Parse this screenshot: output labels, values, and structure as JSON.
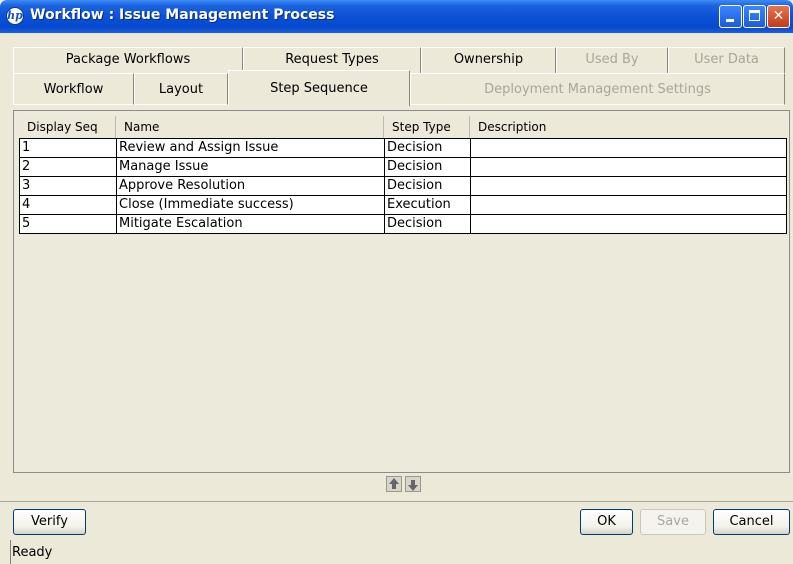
{
  "window": {
    "title": "Workflow : Issue Management Process",
    "icon": "hp-logo-icon",
    "icon_glyph": "hp"
  },
  "tabs": {
    "row1": [
      {
        "label": "Package Workflows",
        "enabled": true
      },
      {
        "label": "Request Types",
        "enabled": true
      },
      {
        "label": "Ownership",
        "enabled": true
      },
      {
        "label": "Used By",
        "enabled": false
      },
      {
        "label": "User Data",
        "enabled": false
      }
    ],
    "row2": [
      {
        "label": "Workflow",
        "enabled": true
      },
      {
        "label": "Layout",
        "enabled": true
      },
      {
        "label": "Step Sequence",
        "enabled": true,
        "selected": true
      },
      {
        "label": "Deployment Management Settings",
        "enabled": false
      }
    ]
  },
  "table": {
    "columns": [
      "Display Seq",
      "Name",
      "Step Type",
      "Description"
    ],
    "rows": [
      {
        "seq": "1",
        "name": "Review and Assign Issue",
        "type": "Decision",
        "description": ""
      },
      {
        "seq": "2",
        "name": "Manage Issue",
        "type": "Decision",
        "description": ""
      },
      {
        "seq": "3",
        "name": "Approve Resolution",
        "type": "Decision",
        "description": ""
      },
      {
        "seq": "4",
        "name": "Close (Immediate success)",
        "type": "Execution",
        "description": ""
      },
      {
        "seq": "5",
        "name": "Mitigate Escalation",
        "type": "Decision",
        "description": ""
      }
    ]
  },
  "buttons": {
    "verify": "Verify",
    "ok": "OK",
    "save": "Save",
    "cancel": "Cancel"
  },
  "status": "Ready",
  "colors": {
    "titlebar": "#0a4fd4",
    "window_bg": "#ece9d8",
    "close_button": "#c23b16"
  }
}
